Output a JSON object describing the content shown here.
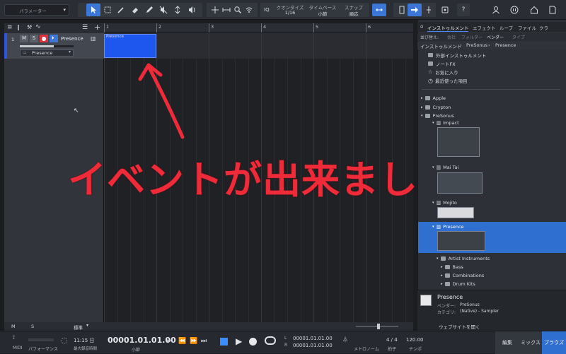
{
  "toolbar": {
    "parameter_label": "パラメーター",
    "quantize_label": "クオンタイズ",
    "quantize_value": "1/16",
    "timebase_label": "タイムベース",
    "timebase_value": "小節",
    "snap_label": "スナップ",
    "snap_value": "順応",
    "iq_label": "IQ"
  },
  "track": {
    "number": "1",
    "mute": "M",
    "solo": "S",
    "name": "Presence",
    "instrument": "Presence"
  },
  "ruler": {
    "marks": [
      "1",
      "2",
      "3",
      "4",
      "5",
      "6"
    ]
  },
  "event": {
    "label": "Presence"
  },
  "overlay": {
    "text": "イベントが出来ました"
  },
  "browser": {
    "tabs": [
      "インストゥルメント",
      "エフェクト",
      "ループ",
      "ファイル",
      "クラ"
    ],
    "sort_label": "並び替え:",
    "sort_options": [
      "会社",
      "フォルダー",
      "ベンダー",
      "タイプ"
    ],
    "breadcrumb": [
      "インストゥルメント",
      "PreSonus",
      "Presence"
    ],
    "tree": [
      "外部インストゥルメント",
      "ノートFX",
      "お気に入り",
      "最近使った項目",
      "Apple",
      "Crypton",
      "PreSonus",
      "Impact",
      "Mai Tai",
      "Mojito",
      "Presence",
      "Artist Instruments",
      "Bass",
      "Combinations",
      "Drum Kits"
    ],
    "info": {
      "title": "Presence",
      "vendor_label": "ベンダー:",
      "vendor_value": "PreSonus",
      "category_label": "カテゴリ:",
      "category_value": "(Native) - Sampler",
      "website_label": "ウェブサイトを開く"
    }
  },
  "trackfooter": {
    "m": "M",
    "s": "S",
    "std": "標準"
  },
  "transport": {
    "midi_label": "MIDI",
    "performance_label": "パフォーマンス",
    "date": "11:15 日",
    "rec_time_label": "最大録音時間",
    "position": "00001.01.01.00",
    "position_unit": "小節",
    "loop_l": "00001.01.01.00",
    "loop_r": "00001.01.01.00",
    "metronome_label": "メトロノーム",
    "signature": "4 / 4",
    "signature_label": "拍子",
    "tempo": "120.00",
    "tempo_label": "テンポ",
    "edit_label": "編集",
    "mix_label": "ミックス",
    "browse_label": "ブラウズ"
  },
  "colors": {
    "accent": "#1e57ee",
    "overlay": "#ef2b3a",
    "selected": "#2f6fcf"
  }
}
